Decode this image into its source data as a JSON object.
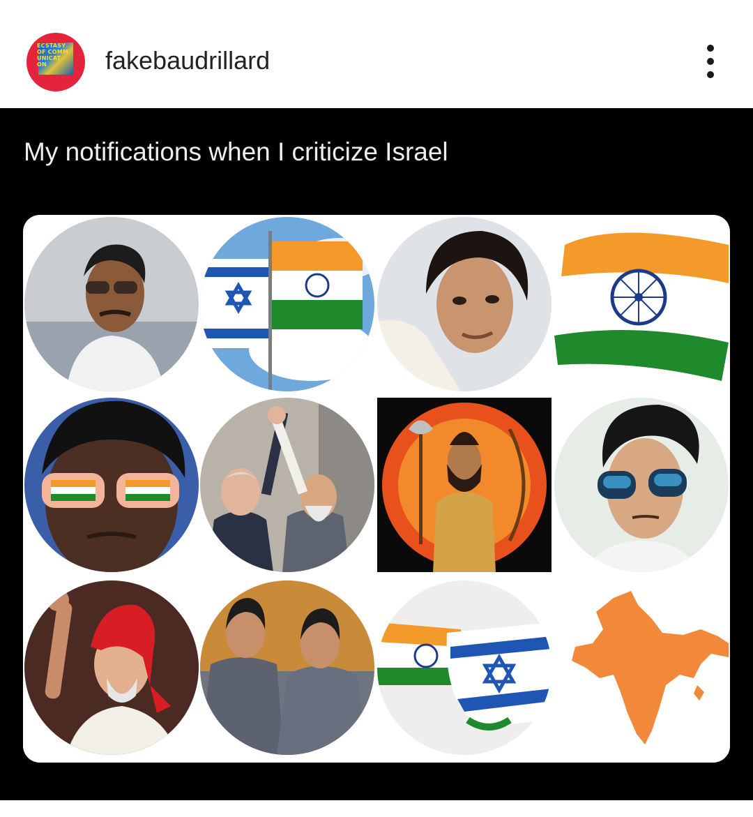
{
  "header": {
    "username": "fakebaudrillard",
    "avatar_text": "ECSTASY\nOF COMM\nUNICAT\nON",
    "more_icon": "more-vertical-icon"
  },
  "post": {
    "caption": "My notifications when I criticize Israel",
    "tiles": [
      {
        "name": "avatar-man-sunglasses"
      },
      {
        "name": "avatar-israel-india-flags"
      },
      {
        "name": "avatar-actor-portrait"
      },
      {
        "name": "avatar-india-flag-brush"
      },
      {
        "name": "avatar-boy-flag-glasses"
      },
      {
        "name": "avatar-leaders-raised-hands"
      },
      {
        "name": "avatar-deity-axe-bow"
      },
      {
        "name": "avatar-young-man-sunglasses"
      },
      {
        "name": "avatar-leader-red-turban"
      },
      {
        "name": "avatar-twin-actors"
      },
      {
        "name": "avatar-flags-handshake"
      },
      {
        "name": "avatar-india-map"
      }
    ]
  },
  "colors": {
    "post_background": "#000000",
    "avatar_ring": "#e4233d",
    "saffron": "#f39a2b",
    "india_green": "#1f8a2c",
    "israel_blue": "#1f56b3"
  }
}
